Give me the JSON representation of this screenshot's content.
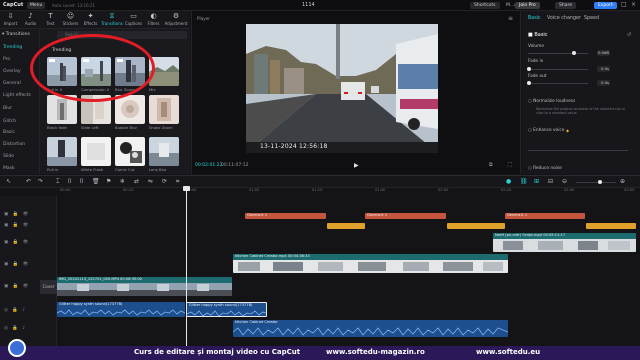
{
  "app": {
    "logo": "CapCut",
    "menu_label": "Menu",
    "autosave": "Auto saved: 13:16:21",
    "project_title": "1114",
    "shortcuts_label": "Shortcuts",
    "user_label": "M...a",
    "join_pro_label": "Join Pro",
    "share_label": "Share",
    "export_label": "Export"
  },
  "media_tabs": [
    {
      "label": "Import",
      "icon": "import-icon"
    },
    {
      "label": "Audio",
      "icon": "audio-icon"
    },
    {
      "label": "Text",
      "icon": "text-icon"
    },
    {
      "label": "Stickers",
      "icon": "stickers-icon"
    },
    {
      "label": "Effects",
      "icon": "effects-icon"
    },
    {
      "label": "Transitions",
      "icon": "transitions-icon",
      "active": true
    },
    {
      "label": "Captions",
      "icon": "captions-icon"
    },
    {
      "label": "Filters",
      "icon": "filters-icon"
    },
    {
      "label": "Adjustment",
      "icon": "adjustment-icon"
    }
  ],
  "sidebar": {
    "header": "Transitions",
    "items": [
      "Trending",
      "Pro",
      "Overlay",
      "General",
      "Light effects",
      "Blur",
      "Glitch",
      "Basic",
      "Distortion",
      "Slide",
      "Mask"
    ]
  },
  "transitions_panel": {
    "search_placeholder": "Search",
    "section_title": "Trending",
    "tiles": [
      {
        "label": "Pull in II",
        "thumb": "pull"
      },
      {
        "label": "Compression II",
        "thumb": "comp"
      },
      {
        "label": "Blur Zoom II",
        "thumb": "blurzoom"
      },
      {
        "label": "Mix",
        "thumb": "mix"
      },
      {
        "label": "Black fade",
        "thumb": "blackfade"
      },
      {
        "label": "Slide Left",
        "thumb": "slideleft"
      },
      {
        "label": "Bubble Blur",
        "thumb": "bubble"
      },
      {
        "label": "Shake Zoom",
        "thumb": "shake"
      },
      {
        "label": "Pull in",
        "thumb": "pullin"
      },
      {
        "label": "White Flash",
        "thumb": "whiteflash"
      },
      {
        "label": "Comic Cut",
        "thumb": "comic"
      },
      {
        "label": "Lens Blur",
        "thumb": "lensblur"
      }
    ]
  },
  "player": {
    "label": "Player",
    "timestamp_overlay": "13-11-2024  12:56:18",
    "time_current": "00:02:01:22",
    "time_total": "00:11:07:12"
  },
  "right_panel": {
    "tabs": [
      "Basic",
      "Voice changer",
      "Speed"
    ],
    "active_tab": "Basic",
    "basic_section": "Basic",
    "volume_label": "Volume",
    "volume_value": "0.0dB",
    "fade_in_label": "Fade in",
    "fade_in_value": "0.0s",
    "fade_out_label": "Fade out",
    "fade_out_value": "0.0s",
    "normalize_label": "Normalize loudness",
    "normalize_desc": "Normalize the original loudness of the selected clip or clips to a standard value.",
    "enhance_label": "Enhance voice",
    "reduce_label": "Reduce noise"
  },
  "timeline": {
    "ruler": [
      "00:00",
      "00:20",
      "00:40",
      "01:00",
      "01:20",
      "01:40",
      "02:00",
      "02:20",
      "02:40",
      "03:00"
    ],
    "clips": {
      "generalt_a": "Genera.lt 1",
      "generalt_b": "Genera.lt 1",
      "generalt_c": "Genera.lt 1",
      "notf_label": "Nortf (pn-ordr) Script.mp4  00:05:11:17",
      "kitchen_label": "kitchen Cabinet Creator.mp4  00:04:36:33",
      "main_label": "IMG_20241113_125721_005.MP4  00:06:35:00",
      "cover_label": "Cover",
      "audio_a": "Glitter happy synth sound(17377B)",
      "audio_b": "Glitter happy synth sound(17377B)",
      "audio_c": "kitchen Cabinet Creator"
    }
  },
  "banner": {
    "text1": "Curs de editare și montaj video cu CapCut",
    "text2": "www.softedu-magazin.ro",
    "text3": "www.softedu.eu"
  },
  "colors": {
    "accent": "#29d3d3",
    "export": "#2f7df6",
    "annotation": "#e31d25",
    "banner": "#2a1859"
  }
}
